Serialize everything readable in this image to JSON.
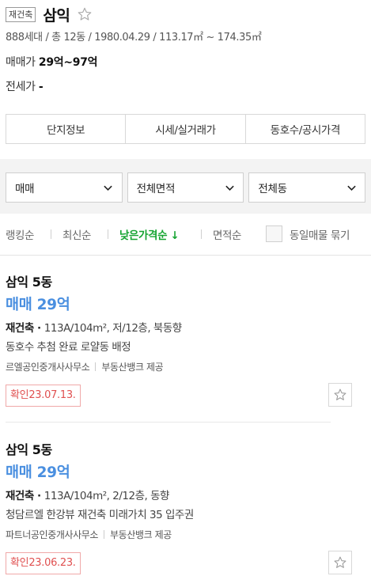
{
  "header": {
    "badge": "재건축",
    "name": "삼익",
    "summary": "888세대 / 총 12동 / 1980.04.29 / 113.17㎡ ~ 174.35㎡",
    "sale_label": "매매가",
    "sale_value": "29억~97억",
    "jeonse_label": "전세가",
    "jeonse_value": "-"
  },
  "tabs": [
    "단지정보",
    "시세/실거래가",
    "동호수/공시가격"
  ],
  "filters": [
    "매매",
    "전체면적",
    "전체동"
  ],
  "sort": {
    "items": [
      "랭킹순",
      "최신순",
      "낮은가격순",
      "면적순"
    ],
    "active_arrow": "↓",
    "active_index": 2,
    "same_listing_label": "동일매물 묶기",
    "active_color": "#15a431"
  },
  "listings": [
    {
      "name": "삼익 5동",
      "price": "매매 29억",
      "type": "재건축",
      "detail": "113A/104m², 저/12층, 북동향",
      "desc": "동호수 추첨 완료 로얄동 배정",
      "agency": "르엘공인중개사사무소",
      "provider": "부동산뱅크 제공",
      "confirm": "확인23.07.13."
    },
    {
      "name": "삼익 5동",
      "price": "매매 29억",
      "type": "재건축",
      "detail": "113A/104m², 2/12층, 동향",
      "desc": "청담르엘 한강뷰 재건축 미래가치 35 입주권",
      "agency": "파트너공인중개사사무소",
      "provider": "부동산뱅크 제공",
      "confirm": "확인23.06.23."
    }
  ],
  "colors": {
    "price_blue": "#4a8fe0",
    "confirm_red": "#e05050"
  }
}
